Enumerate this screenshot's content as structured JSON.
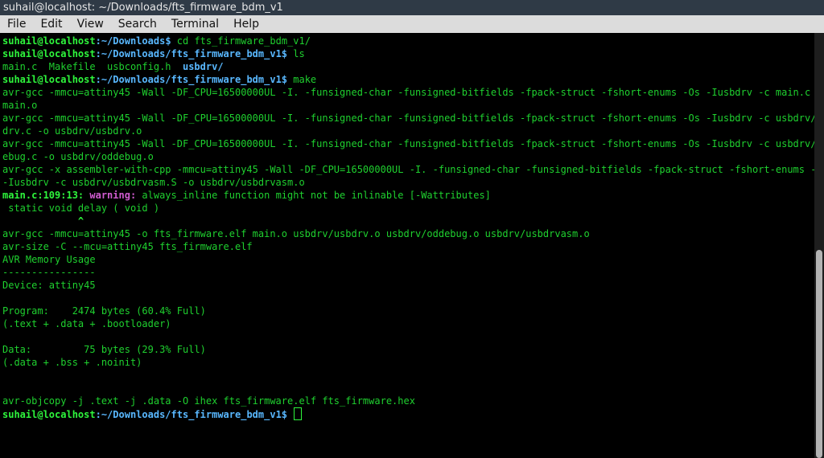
{
  "window": {
    "title": "suhail@localhost: ~/Downloads/fts_firmware_bdm_v1"
  },
  "menu": [
    "File",
    "Edit",
    "View",
    "Search",
    "Terminal",
    "Help"
  ],
  "prompt": {
    "user": "suhail@localhost",
    "sep": ":"
  },
  "terminal": {
    "lines": [
      {
        "type": "prompt",
        "path": "~/Downloads",
        "cmd": " cd fts_firmware_bdm_v1/"
      },
      {
        "type": "prompt",
        "path": "~/Downloads/fts_firmware_bdm_v1",
        "cmd": " ls"
      },
      {
        "type": "ls",
        "plain": "main.c  Makefile  usbconfig.h  ",
        "dir": "usbdrv/"
      },
      {
        "type": "prompt",
        "path": "~/Downloads/fts_firmware_bdm_v1",
        "cmd": " make"
      },
      {
        "type": "text",
        "text": "avr-gcc -mmcu=attiny45 -Wall -DF_CPU=16500000UL -I. -funsigned-char -funsigned-bitfields -fpack-struct -fshort-enums -Os -Iusbdrv -c main.c -o"
      },
      {
        "type": "text",
        "text": "main.o"
      },
      {
        "type": "text",
        "text": "avr-gcc -mmcu=attiny45 -Wall -DF_CPU=16500000UL -I. -funsigned-char -funsigned-bitfields -fpack-struct -fshort-enums -Os -Iusbdrv -c usbdrv/usb"
      },
      {
        "type": "text",
        "text": "drv.c -o usbdrv/usbdrv.o"
      },
      {
        "type": "text",
        "text": "avr-gcc -mmcu=attiny45 -Wall -DF_CPU=16500000UL -I. -funsigned-char -funsigned-bitfields -fpack-struct -fshort-enums -Os -Iusbdrv -c usbdrv/odd"
      },
      {
        "type": "text",
        "text": "ebug.c -o usbdrv/oddebug.o"
      },
      {
        "type": "text",
        "text": "avr-gcc -x assembler-with-cpp -mmcu=attiny45 -Wall -DF_CPU=16500000UL -I. -funsigned-char -funsigned-bitfields -fpack-struct -fshort-enums -Os"
      },
      {
        "type": "text",
        "text": "-Iusbdrv -c usbdrv/usbdrvasm.S -o usbdrv/usbdrvasm.o"
      },
      {
        "type": "warning",
        "loc": "main.c:109:13:",
        "label": " warning:",
        "msg": " always_inline function might not be inlinable [-Wattributes]"
      },
      {
        "type": "text",
        "text": " static void delay ( void )"
      },
      {
        "type": "caret",
        "text": "             ^"
      },
      {
        "type": "text",
        "text": "avr-gcc -mmcu=attiny45 -o fts_firmware.elf main.o usbdrv/usbdrv.o usbdrv/oddebug.o usbdrv/usbdrvasm.o"
      },
      {
        "type": "text",
        "text": "avr-size -C --mcu=attiny45 fts_firmware.elf"
      },
      {
        "type": "text",
        "text": "AVR Memory Usage"
      },
      {
        "type": "text",
        "text": "----------------"
      },
      {
        "type": "text",
        "text": "Device: attiny45"
      },
      {
        "type": "text",
        "text": ""
      },
      {
        "type": "text",
        "text": "Program:    2474 bytes (60.4% Full)"
      },
      {
        "type": "text",
        "text": "(.text + .data + .bootloader)"
      },
      {
        "type": "text",
        "text": ""
      },
      {
        "type": "text",
        "text": "Data:         75 bytes (29.3% Full)"
      },
      {
        "type": "text",
        "text": "(.data + .bss + .noinit)"
      },
      {
        "type": "text",
        "text": ""
      },
      {
        "type": "text",
        "text": ""
      },
      {
        "type": "text",
        "text": "avr-objcopy -j .text -j .data -O ihex fts_firmware.elf fts_firmware.hex"
      },
      {
        "type": "prompt",
        "path": "~/Downloads/fts_firmware_bdm_v1",
        "cmd": " ",
        "cursor": true
      }
    ]
  },
  "scrollbar": {
    "position": 0.51
  },
  "colors": {
    "user": "#2ef53c",
    "path": "#59b8ff",
    "text": "#1fd12f",
    "warning": "#d05cd0",
    "background": "#000000"
  }
}
